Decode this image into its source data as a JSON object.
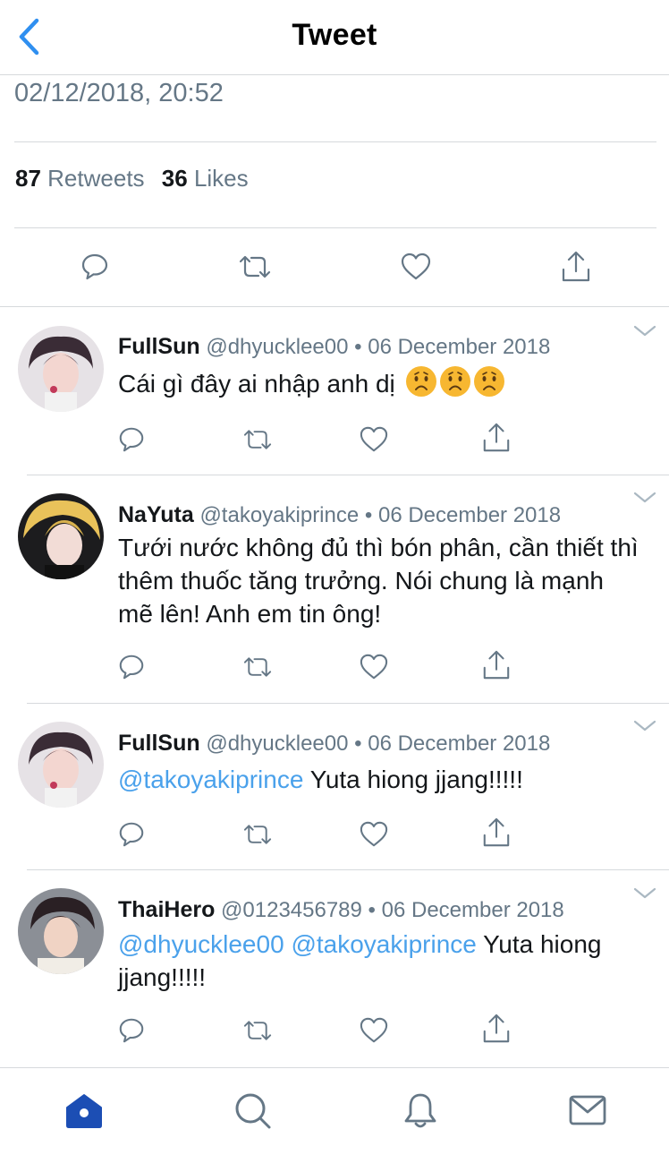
{
  "header": {
    "title": "Tweet"
  },
  "tweet": {
    "timestamp": "02/12/2018, 20:52",
    "retweets_count": "87",
    "retweets_label": "Retweets",
    "likes_count": "36",
    "likes_label": "Likes"
  },
  "replies": [
    {
      "name": "FullSun",
      "handle": "@dhyucklee00",
      "separator": "•",
      "date": "06 December 2018",
      "text": "Cái gì đây ai nhập anh dị",
      "emojis": [
        "worried-face-emoji",
        "worried-face-emoji",
        "worried-face-emoji"
      ]
    },
    {
      "name": "NaYuta",
      "handle": "@takoyakiprince",
      "separator": "•",
      "date": "06 December 2018",
      "text": "Tưới nước không đủ thì bón phân, cần thiết thì thêm thuốc tăng trưởng. Nói chung là mạnh mẽ lên! Anh em tin ông!"
    },
    {
      "name": "FullSun",
      "handle": "@dhyucklee00",
      "separator": "•",
      "date": "06 December 2018",
      "mention1": "@takoyakiprince",
      "text": "Yuta hiong jjang!!!!!"
    },
    {
      "name": "ThaiHero",
      "handle": "@0123456789",
      "separator": "•",
      "date": "06 December 2018",
      "mention1": "@dhyucklee00",
      "mention2": "@takoyakiprince",
      "text": "Yuta hiong jjang!!!!!"
    }
  ],
  "icons": {
    "back": "chevron-left-icon",
    "reply": "reply-bubble-icon",
    "retweet": "retweet-icon",
    "like": "heart-icon",
    "share": "share-icon",
    "more": "chevron-down-icon",
    "tabs": [
      "home-icon",
      "search-icon",
      "bell-icon",
      "mail-icon"
    ]
  },
  "colors": {
    "accent": "#1da1f2",
    "mention": "#4aa1eb",
    "muted": "#657786",
    "nav_active": "#1c4eb4"
  }
}
